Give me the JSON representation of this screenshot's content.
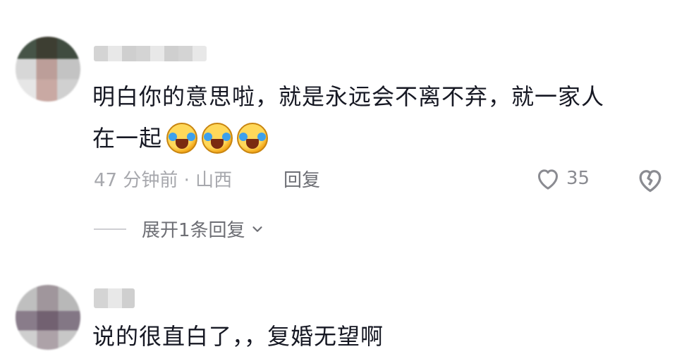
{
  "comments": [
    {
      "text_line1": "明白你的意思啦，就是永远会不离不弃，就一家人",
      "text_line2": "在一起",
      "emojis": [
        "laugh-cry-emoji",
        "laugh-cry-emoji",
        "laugh-cry-emoji"
      ],
      "time_location": "47 分钟前 · 山西",
      "reply_label": "回复",
      "like_count": "35",
      "expand_label": "展开1条回复"
    },
    {
      "text": "说的很直白了，，复婚无望啊"
    }
  ],
  "colors": {
    "text": "#161823",
    "meta": "#a7a8ad",
    "secondary": "#6e6f75"
  }
}
